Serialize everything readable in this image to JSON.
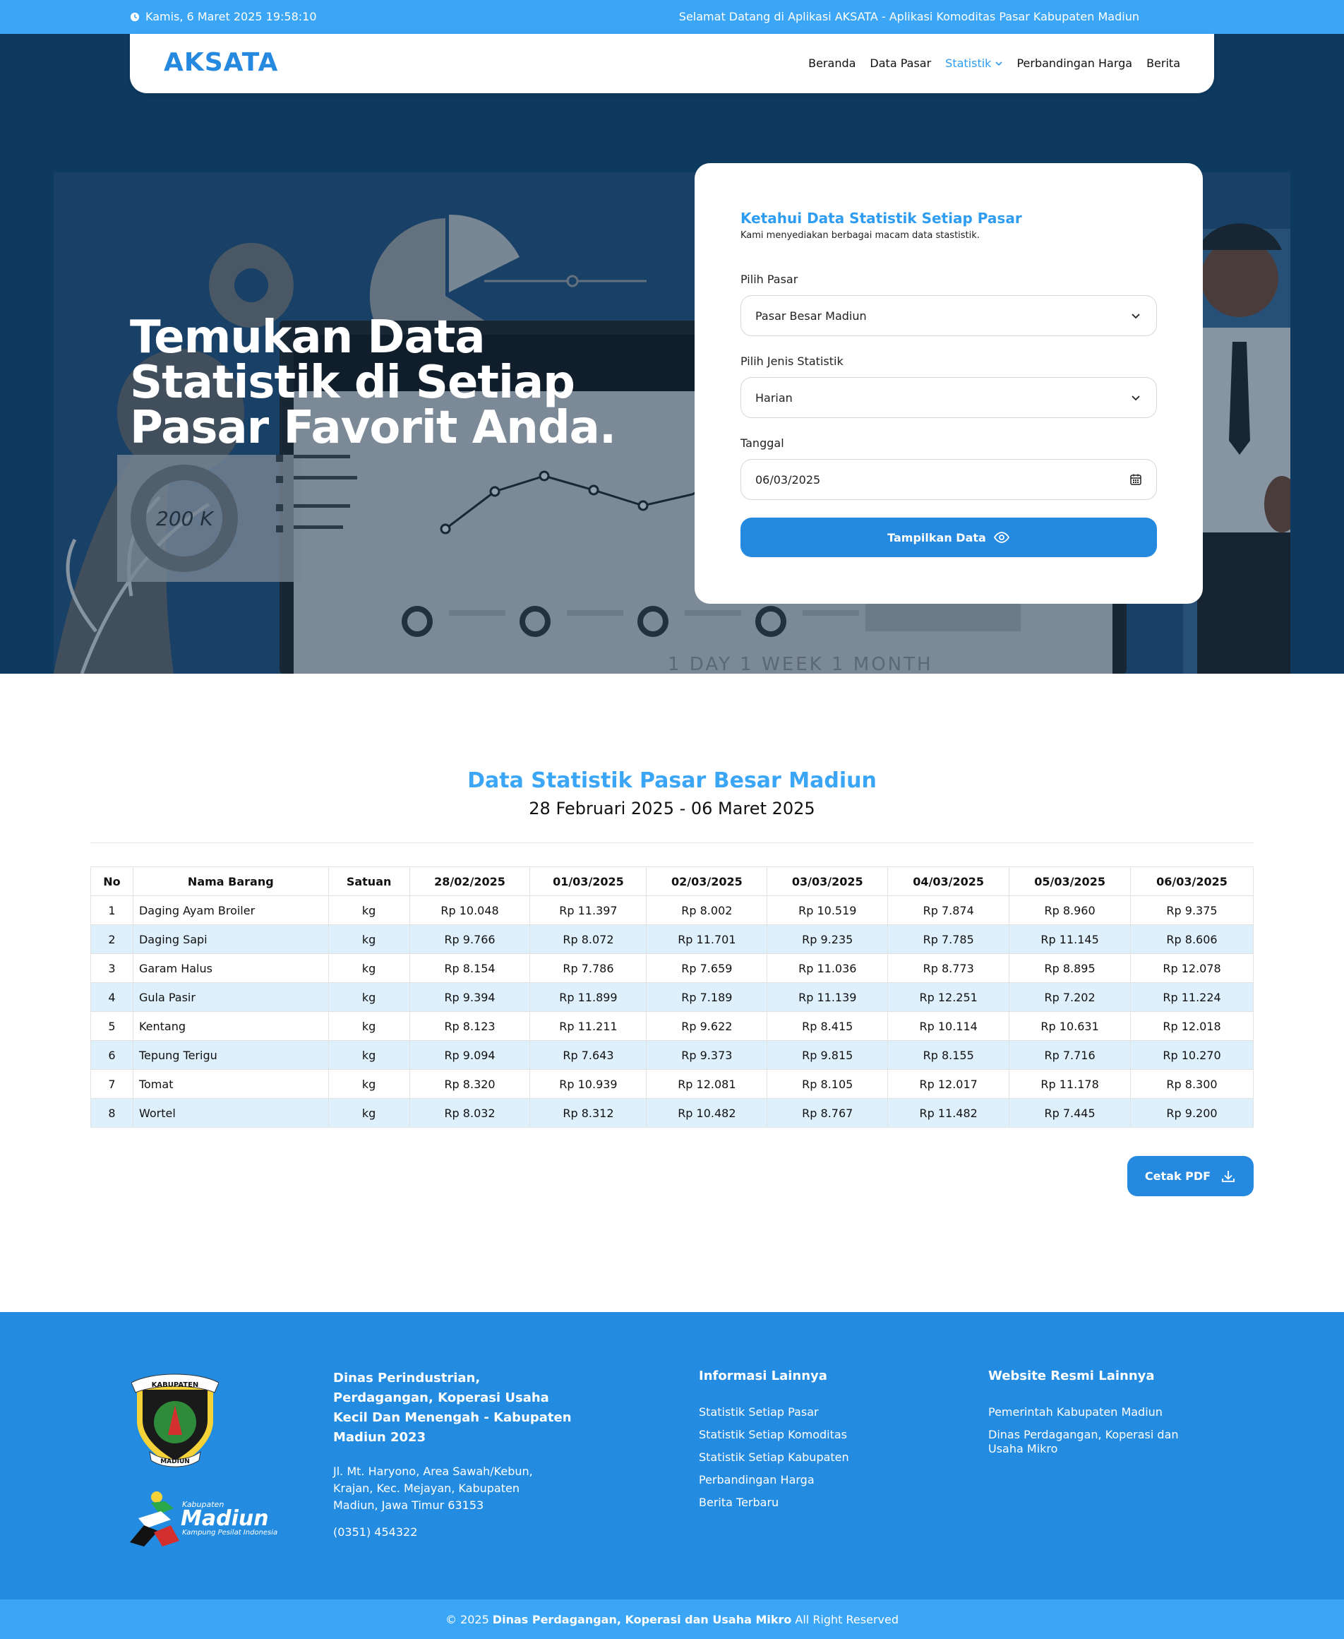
{
  "topbar": {
    "datetime": "Kamis, 6 Maret 2025 19:58:10",
    "marquee": "Selamat Datang di Aplikasi AKSATA - Aplikasi Komoditas Pasar Kabupaten Madiun"
  },
  "navbar": {
    "logo": "AKSATA",
    "items": [
      "Beranda",
      "Data Pasar",
      "Statistik",
      "Perbandingan Harga",
      "Berita"
    ]
  },
  "hero": {
    "title": "Temukan Data Statistik di Setiap Pasar Favorit Anda.",
    "illustration_text": {
      "donut_value": "200 K",
      "period_tabs": "1 DAY   1 WEEK   1 MONTH"
    }
  },
  "form": {
    "title": "Ketahui Data Statistik Setiap Pasar",
    "subtitle": "Kami menyediakan berbagai macam data stastistik.",
    "pasar_label": "Pilih Pasar",
    "pasar_value": "Pasar Besar Madiun",
    "jenis_label": "Pilih Jenis Statistik",
    "jenis_value": "Harian",
    "tanggal_label": "Tanggal",
    "tanggal_value": "06/03/2025",
    "button_label": "Tampilkan Data"
  },
  "stats": {
    "title": "Data Statistik Pasar Besar Madiun",
    "range": "28 Februari 2025 - 06 Maret 2025",
    "headers": [
      "No",
      "Nama Barang",
      "Satuan",
      "28/02/2025",
      "01/03/2025",
      "02/03/2025",
      "03/03/2025",
      "04/03/2025",
      "05/03/2025",
      "06/03/2025"
    ],
    "rows": [
      [
        "1",
        "Daging Ayam Broiler",
        "kg",
        "Rp 10.048",
        "Rp 11.397",
        "Rp 8.002",
        "Rp 10.519",
        "Rp 7.874",
        "Rp 8.960",
        "Rp 9.375"
      ],
      [
        "2",
        "Daging Sapi",
        "kg",
        "Rp 9.766",
        "Rp 8.072",
        "Rp 11.701",
        "Rp 9.235",
        "Rp 7.785",
        "Rp 11.145",
        "Rp 8.606"
      ],
      [
        "3",
        "Garam Halus",
        "kg",
        "Rp 8.154",
        "Rp 7.786",
        "Rp 7.659",
        "Rp 11.036",
        "Rp 8.773",
        "Rp 8.895",
        "Rp 12.078"
      ],
      [
        "4",
        "Gula Pasir",
        "kg",
        "Rp 9.394",
        "Rp 11.899",
        "Rp 7.189",
        "Rp 11.139",
        "Rp 12.251",
        "Rp 7.202",
        "Rp 11.224"
      ],
      [
        "5",
        "Kentang",
        "kg",
        "Rp 8.123",
        "Rp 11.211",
        "Rp 9.622",
        "Rp 8.415",
        "Rp 10.114",
        "Rp 10.631",
        "Rp 12.018"
      ],
      [
        "6",
        "Tepung Terigu",
        "kg",
        "Rp 9.094",
        "Rp 7.643",
        "Rp 9.373",
        "Rp 9.815",
        "Rp 8.155",
        "Rp 7.716",
        "Rp 10.270"
      ],
      [
        "7",
        "Tomat",
        "kg",
        "Rp 8.320",
        "Rp 10.939",
        "Rp 12.081",
        "Rp 8.105",
        "Rp 12.017",
        "Rp 11.178",
        "Rp 8.300"
      ],
      [
        "8",
        "Wortel",
        "kg",
        "Rp 8.032",
        "Rp 8.312",
        "Rp 10.482",
        "Rp 8.767",
        "Rp 11.482",
        "Rp 7.445",
        "Rp 9.200"
      ]
    ],
    "pdf_button": "Cetak PDF"
  },
  "footer": {
    "crest_text": {
      "top": "KABUPATEN",
      "bottom": "MADIUN"
    },
    "madiun_logo": {
      "small": "Kabupaten",
      "big": "Madiun",
      "tagline": "Kampung Pesilat Indonesia"
    },
    "org": "Dinas Perindustrian, Perdagangan, Koperasi Usaha Kecil Dan Menengah - Kabupaten Madiun 2023",
    "address": "Jl. Mt. Haryono, Area Sawah/Kebun, Krajan, Kec. Mejayan, Kabupaten Madiun, Jawa Timur 63153",
    "phone": "(0351) 454322",
    "info_title": "Informasi Lainnya",
    "info_links": [
      "Statistik Setiap Pasar",
      "Statistik Setiap Komoditas",
      "Statistik Setiap Kabupaten",
      "Perbandingan Harga",
      "Berita Terbaru"
    ],
    "web_title": "Website Resmi Lainnya",
    "web_links": [
      "Pemerintah Kabupaten Madiun",
      "Dinas Perdagangan, Koperasi dan Usaha Mikro"
    ],
    "copyright_prefix": "© 2025",
    "copyright_org": "Dinas Perdagangan, Koperasi dan Usaha Mikro",
    "copyright_suffix": "All Right Reserved"
  }
}
